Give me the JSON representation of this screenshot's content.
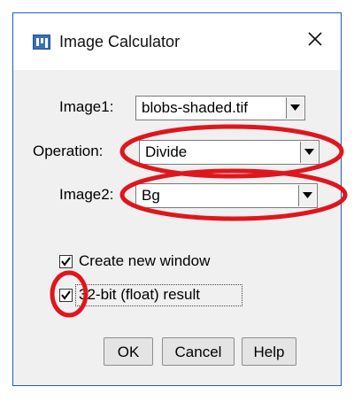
{
  "window": {
    "title": "Image Calculator",
    "app_icon": "imagej-icon",
    "close_icon": "close-icon"
  },
  "fields": {
    "image1": {
      "label": "Image1:",
      "value": "blobs-shaded.tif"
    },
    "operation": {
      "label": "Operation:",
      "value": "Divide"
    },
    "image2": {
      "label": "Image2:",
      "value": "Bg"
    }
  },
  "options": {
    "create_new_window": {
      "label": "Create new window",
      "checked": true
    },
    "float_result": {
      "label": "32-bit (float) result",
      "checked": true
    }
  },
  "buttons": {
    "ok": "OK",
    "cancel": "Cancel",
    "help": "Help"
  },
  "annotations": {
    "color": "#e0161d",
    "items": [
      "operation-highlight",
      "image2-highlight",
      "float-checkbox-highlight"
    ]
  }
}
